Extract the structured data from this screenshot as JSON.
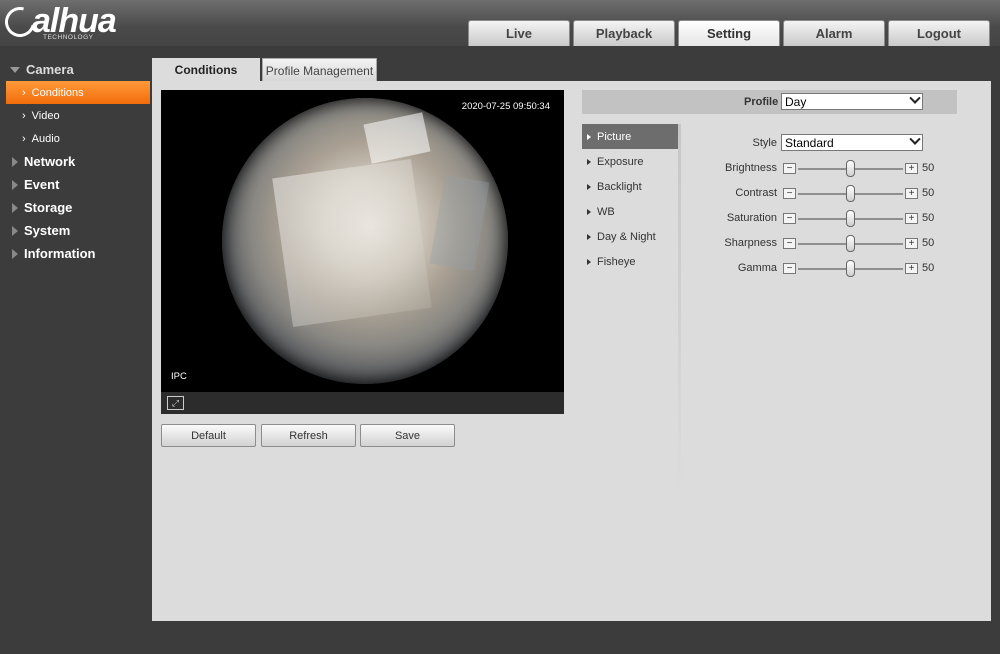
{
  "brand": {
    "logo_text": "alhua",
    "logo_sub": "TECHNOLOGY"
  },
  "topnav": [
    "Live",
    "Playback",
    "Setting",
    "Alarm",
    "Logout"
  ],
  "topnav_active": "Setting",
  "sidebar": {
    "camera": {
      "label": "Camera",
      "items": [
        "Conditions",
        "Video",
        "Audio"
      ],
      "active": "Conditions"
    },
    "categories": [
      "Network",
      "Event",
      "Storage",
      "System",
      "Information"
    ]
  },
  "tabs": [
    "Conditions",
    "Profile Management"
  ],
  "video": {
    "timestamp": "2020-07-25 09:50:34",
    "channel_label": "IPC"
  },
  "buttons": {
    "default": "Default",
    "refresh": "Refresh",
    "save": "Save"
  },
  "profile": {
    "label": "Profile",
    "value": "Day"
  },
  "submenu": [
    "Picture",
    "Exposure",
    "Backlight",
    "WB",
    "Day & Night",
    "Fisheye"
  ],
  "submenu_active": "Picture",
  "style": {
    "label": "Style",
    "value": "Standard"
  },
  "sliders": [
    {
      "label": "Brightness",
      "value": "50"
    },
    {
      "label": "Contrast",
      "value": "50"
    },
    {
      "label": "Saturation",
      "value": "50"
    },
    {
      "label": "Sharpness",
      "value": "50"
    },
    {
      "label": "Gamma",
      "value": "50"
    }
  ],
  "colors": {
    "accent_orange": "#f26c0a",
    "panel_bg": "#dcdcdc",
    "page_bg": "#3c3c3c"
  }
}
